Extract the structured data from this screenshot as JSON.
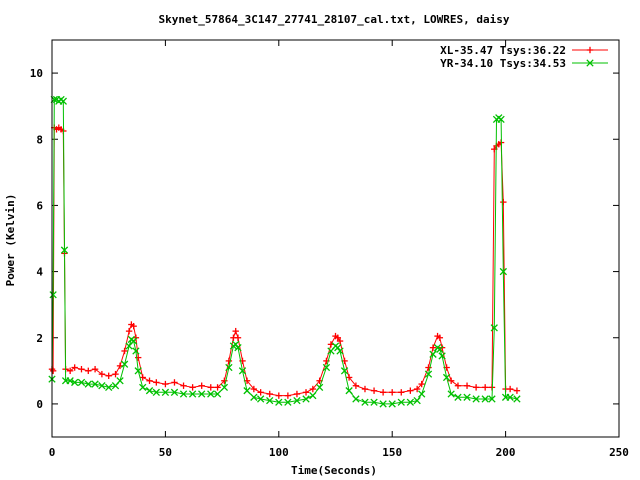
{
  "chart_data": {
    "type": "line",
    "title": "Skynet_57864_3C147_27741_28107_cal.txt, LOWRES, daisy",
    "xlabel": "Time(Seconds)",
    "ylabel": "Power (Kelvin)",
    "xlim": [
      0,
      250
    ],
    "ylim": [
      -1,
      11
    ],
    "xticks": [
      0,
      50,
      100,
      150,
      200,
      250
    ],
    "yticks": [
      0,
      2,
      4,
      6,
      8,
      10
    ],
    "grid": false,
    "legend_position": "top-right",
    "series": [
      {
        "name": "XL-35.47 Tsys:36.22",
        "color": "#ff0000",
        "marker": "plus",
        "x": [
          0,
          0.5,
          1,
          2,
          3,
          4,
          5,
          5.5,
          6,
          8,
          10,
          13,
          16,
          19,
          22,
          25,
          28,
          30,
          32,
          34,
          35,
          36,
          37,
          38,
          40,
          43,
          46,
          50,
          54,
          58,
          62,
          66,
          70,
          73,
          76,
          78,
          80,
          81,
          82,
          84,
          86,
          89,
          92,
          96,
          100,
          104,
          108,
          112,
          115,
          118,
          121,
          123,
          125,
          126,
          127,
          129,
          131,
          134,
          138,
          142,
          146,
          150,
          154,
          158,
          161,
          163,
          166,
          168,
          170,
          171,
          172,
          174,
          176,
          179,
          183,
          187,
          191,
          194,
          195,
          196,
          197,
          198,
          199,
          200,
          202,
          205
        ],
        "y": [
          1.05,
          1.0,
          8.35,
          8.3,
          8.35,
          8.3,
          8.25,
          4.55,
          1.05,
          1.0,
          1.1,
          1.05,
          1.0,
          1.05,
          0.9,
          0.85,
          0.9,
          1.15,
          1.6,
          2.2,
          2.4,
          2.35,
          2.0,
          1.4,
          0.8,
          0.7,
          0.65,
          0.6,
          0.65,
          0.55,
          0.5,
          0.55,
          0.5,
          0.5,
          0.7,
          1.3,
          2.0,
          2.2,
          2.0,
          1.3,
          0.7,
          0.45,
          0.35,
          0.3,
          0.25,
          0.25,
          0.3,
          0.35,
          0.45,
          0.7,
          1.3,
          1.8,
          2.05,
          2.0,
          1.9,
          1.3,
          0.8,
          0.55,
          0.45,
          0.4,
          0.35,
          0.35,
          0.35,
          0.4,
          0.45,
          0.6,
          1.1,
          1.7,
          2.05,
          2.0,
          1.7,
          1.1,
          0.7,
          0.55,
          0.55,
          0.5,
          0.5,
          0.5,
          7.7,
          7.8,
          7.85,
          7.9,
          6.1,
          0.45,
          0.45,
          0.4
        ]
      },
      {
        "name": "YR-34.10 Tsys:34.53",
        "color": "#00c000",
        "marker": "cross",
        "x": [
          0,
          0.5,
          1,
          2,
          3,
          4,
          5,
          5.5,
          6,
          8,
          10,
          13,
          16,
          19,
          22,
          25,
          28,
          30,
          32,
          34,
          35,
          36,
          37,
          38,
          40,
          43,
          46,
          50,
          54,
          58,
          62,
          66,
          70,
          73,
          76,
          78,
          80,
          81,
          82,
          84,
          86,
          89,
          92,
          96,
          100,
          104,
          108,
          112,
          115,
          118,
          121,
          123,
          125,
          126,
          127,
          129,
          131,
          134,
          138,
          142,
          146,
          150,
          154,
          158,
          161,
          163,
          166,
          168,
          170,
          171,
          172,
          174,
          176,
          179,
          183,
          187,
          191,
          194,
          195,
          196,
          197,
          198,
          199,
          200,
          202,
          205
        ],
        "y": [
          0.75,
          3.3,
          9.2,
          9.2,
          9.15,
          9.2,
          9.15,
          4.65,
          0.7,
          0.7,
          0.65,
          0.65,
          0.6,
          0.6,
          0.55,
          0.5,
          0.55,
          0.7,
          1.2,
          1.75,
          1.95,
          1.9,
          1.6,
          1.0,
          0.5,
          0.4,
          0.35,
          0.35,
          0.35,
          0.3,
          0.3,
          0.3,
          0.3,
          0.3,
          0.5,
          1.1,
          1.75,
          1.8,
          1.7,
          1.0,
          0.4,
          0.2,
          0.15,
          0.1,
          0.05,
          0.05,
          0.1,
          0.15,
          0.25,
          0.5,
          1.1,
          1.6,
          1.75,
          1.7,
          1.6,
          1.0,
          0.4,
          0.15,
          0.05,
          0.05,
          0.0,
          0.0,
          0.05,
          0.05,
          0.1,
          0.3,
          0.9,
          1.5,
          1.7,
          1.65,
          1.45,
          0.8,
          0.3,
          0.2,
          0.2,
          0.15,
          0.15,
          0.15,
          2.3,
          8.6,
          8.65,
          8.6,
          4.0,
          0.2,
          0.2,
          0.15
        ]
      }
    ]
  }
}
